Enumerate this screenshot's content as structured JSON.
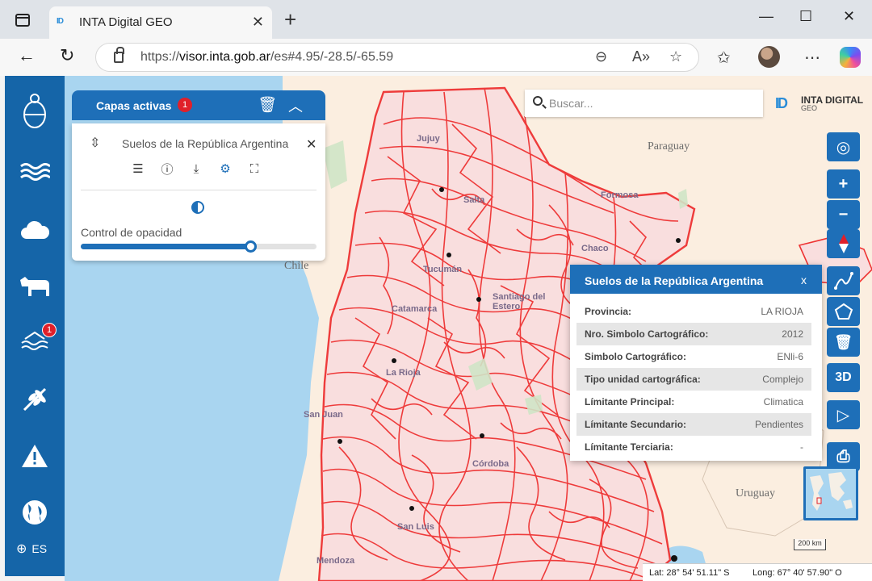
{
  "browser": {
    "tab_title": "INTA Digital GEO",
    "tab_favicon": "ID",
    "new_tab": "+",
    "url_prefix": "https://",
    "url_host": "visor.inta.gob.ar",
    "url_path": "/es#4.95/-28.5/-65.59",
    "icons": [
      "window-icon",
      "back-icon",
      "reload-icon",
      "lock-icon",
      "zoom-out-icon",
      "read-aloud-icon",
      "favorite-star-icon",
      "favorites-icon",
      "profile-avatar",
      "more-icon",
      "copilot-icon",
      "minimize-icon",
      "maximize-icon",
      "close-icon"
    ]
  },
  "sidebar": {
    "items": [
      {
        "name": "coat-of-arms-icon"
      },
      {
        "name": "water-icon"
      },
      {
        "name": "weather-cloud-icon"
      },
      {
        "name": "livestock-cow-icon"
      },
      {
        "name": "flood-water-icon",
        "badge": "1"
      },
      {
        "name": "crop-wheat-icon"
      },
      {
        "name": "warning-icon"
      },
      {
        "name": "earth-globe-icon"
      }
    ],
    "language": "ES",
    "color": "#1565a8"
  },
  "layers_panel": {
    "title": "Capas activas",
    "badge": "1",
    "layer_name": "Suelos de la República Argentina",
    "opacity_label": "Control de opacidad",
    "opacity": 0.72,
    "accent": "#1e6fb8"
  },
  "search": {
    "placeholder": "Buscar..."
  },
  "brand": {
    "mark": "ID",
    "main": "INTA DIGITAL",
    "sub": "GEO"
  },
  "map_labels": {
    "paraguay": "Paraguay",
    "chile": "Chile",
    "uruguay": "Uruguay",
    "jujuy": "Jujuy",
    "salta": "Salta",
    "formosa": "Formosa",
    "chaco": "Chaco",
    "tucuman": "Tucumán",
    "santiago": "Santiago del Estero",
    "catamarca": "Catamarca",
    "la_rioja": "La Rioja",
    "san_juan": "San Juan",
    "cordoba": "Córdoba",
    "san_luis": "San Luis",
    "mendoza": "Mendoza"
  },
  "map_tools": {
    "three_d": "3D"
  },
  "info_popup": {
    "title": "Suelos de la República Argentina",
    "close": "x",
    "rows": [
      {
        "key": "Provincia:",
        "value": "LA RIOJA"
      },
      {
        "key": "Nro. Simbolo Cartográfico:",
        "value": "2012"
      },
      {
        "key": "Simbolo Cartográfico:",
        "value": "ENli-6"
      },
      {
        "key": "Tipo unidad cartográfica:",
        "value": "Complejo"
      },
      {
        "key": "Límitante Principal:",
        "value": "Climatica"
      },
      {
        "key": "Límitante Secundario:",
        "value": "Pendientes"
      },
      {
        "key": "Límitante Terciaria:",
        "value": "-"
      }
    ]
  },
  "scale": "200 km",
  "coords": {
    "lat": "Lat: 28° 54' 51.11\" S",
    "lon": "Long: 67° 40' 57.90\" O"
  }
}
